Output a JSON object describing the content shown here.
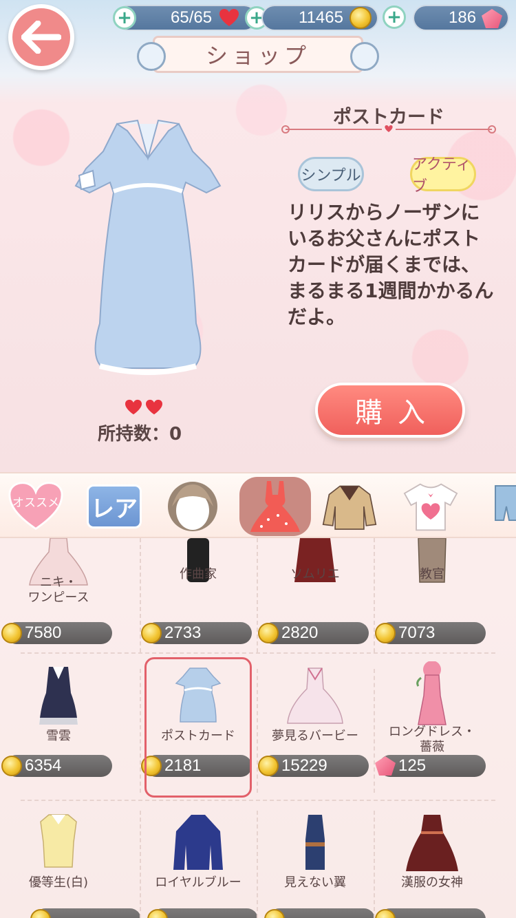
{
  "header": {
    "title": "ショップ",
    "stamina": "65/65",
    "gold": "11465",
    "diamonds": "186"
  },
  "detail": {
    "name": "ポストカード",
    "tags": [
      "シンプル",
      "アクティブ"
    ],
    "description": "リリスからノーザンにいるお父さんにポストカードが届くまでは、まるまる1週間かかるんだよ。",
    "owned_label": "所持数：0",
    "buy_label": "購入"
  },
  "categories": {
    "recommend": "オススメ",
    "rare": "レア"
  },
  "items": [
    {
      "name": "ニキ・\nワンピース",
      "price": "7580",
      "currency": "gold",
      "color": "#f4dada"
    },
    {
      "name": "作曲家",
      "price": "2733",
      "currency": "gold",
      "color": "#2a2a2a"
    },
    {
      "name": "ソムリエ",
      "price": "2820",
      "currency": "gold",
      "color": "#7a2222"
    },
    {
      "name": "教官",
      "price": "7073",
      "currency": "gold",
      "color": "#a08a7a"
    },
    {
      "name": "雪雲",
      "price": "6354",
      "currency": "gold",
      "color": "#2e3150"
    },
    {
      "name": "ポストカード",
      "price": "2181",
      "currency": "gold",
      "color": "#b6cfea"
    },
    {
      "name": "夢見るバービー",
      "price": "15229",
      "currency": "gold",
      "color": "#f6e3ea"
    },
    {
      "name": "ロングドレス・\n薔薇",
      "price": "125",
      "currency": "diamond",
      "color": "#f08fa8"
    },
    {
      "name": "優等生(白)",
      "price": "",
      "currency": "gold",
      "color": "#f7eaa5"
    },
    {
      "name": "ロイヤルブルー",
      "price": "",
      "currency": "gold",
      "color": "#2c3a8c"
    },
    {
      "name": "見えない翼",
      "price": "",
      "currency": "gold",
      "color": "#2c3f70"
    },
    {
      "name": "漢服の女神",
      "price": "",
      "currency": "gold",
      "color": "#6a2020"
    }
  ]
}
